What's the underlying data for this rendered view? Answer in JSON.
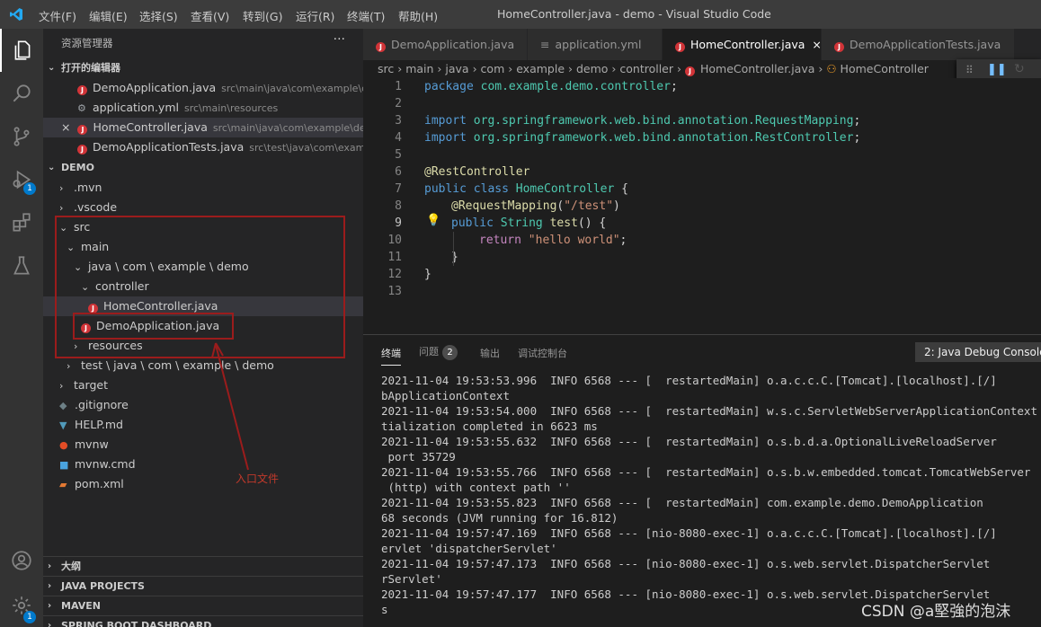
{
  "titlebar": {
    "menus": [
      "文件(F)",
      "编辑(E)",
      "选择(S)",
      "查看(V)",
      "转到(G)",
      "运行(R)",
      "终端(T)",
      "帮助(H)"
    ],
    "title": "HomeController.java - demo - Visual Studio Code"
  },
  "activity": {
    "run_badge": "1",
    "account_badge": "1"
  },
  "sidebar": {
    "title": "资源管理器",
    "more": "···",
    "open_editors_label": "打开的编辑器",
    "open_editors": [
      {
        "name": "DemoApplication.java",
        "path": "src\\main\\java\\com\\example\\d...",
        "icon": "java-icon"
      },
      {
        "name": "application.yml",
        "path": "src\\main\\resources",
        "icon": "gear-icon"
      },
      {
        "name": "HomeController.java",
        "path": "src\\main\\java\\com\\example\\de...",
        "icon": "java-icon",
        "close": "×"
      },
      {
        "name": "DemoApplicationTests.java",
        "path": "src\\test\\java\\com\\exampl...",
        "icon": "java-icon"
      }
    ],
    "project_label": "DEMO",
    "tree": [
      {
        "label": ".mvn",
        "chev": "›"
      },
      {
        "label": ".vscode",
        "chev": "›"
      },
      {
        "label": "src",
        "chev": "⌄"
      },
      {
        "label": "main",
        "chev": "⌄"
      },
      {
        "label": "java \\ com \\ example \\ demo",
        "chev": "⌄"
      },
      {
        "label": "controller",
        "chev": "⌄"
      },
      {
        "label": "HomeController.java"
      },
      {
        "label": "DemoApplication.java"
      },
      {
        "label": "resources",
        "chev": "›"
      },
      {
        "label": "test \\ java \\ com \\ example \\ demo",
        "chev": "›"
      },
      {
        "label": "target",
        "chev": "›"
      },
      {
        "label": ".gitignore"
      },
      {
        "label": "HELP.md"
      },
      {
        "label": "mvnw"
      },
      {
        "label": "mvnw.cmd"
      },
      {
        "label": "pom.xml"
      }
    ],
    "outline_label": "大纲",
    "java_projects_label": "JAVA PROJECTS",
    "maven_label": "MAVEN",
    "spring_label": "SPRING BOOT DASHBOARD"
  },
  "tabs": [
    {
      "label": "DemoApplication.java",
      "icon": "java-icon"
    },
    {
      "label": "application.yml",
      "icon": "settings-icon"
    },
    {
      "label": "HomeController.java",
      "icon": "java-icon",
      "active": true,
      "close": "×"
    },
    {
      "label": "DemoApplicationTests.java",
      "icon": "java-icon"
    }
  ],
  "breadcrumb": [
    "src",
    "main",
    "java",
    "com",
    "example",
    "demo",
    "controller",
    "HomeController.java",
    "HomeController"
  ],
  "code": {
    "line_numbers": [
      "1",
      "2",
      "3",
      "4",
      "5",
      "6",
      "7",
      "8",
      "9",
      "10",
      "11",
      "12",
      "13"
    ],
    "l1a": "package ",
    "l1b": "com.example.demo.controller",
    ";": ";",
    "l3a": "import ",
    "l3b": "org.springframework.web.bind.annotation.RequestMapping",
    "l4b": "org.springframework.web.bind.annotation.RestController",
    "l6a": "@",
    "l6b": "RestController",
    "l7a": "public class ",
    "l7b": "HomeController",
    " l7c": " {",
    "l8a": "@",
    "l8b": "RequestMapping",
    "l8c": "(",
    "l8d": "\"/test\"",
    "l8e": ")",
    "l9a": "public ",
    "l9b": "String ",
    "l9c": "test",
    "l9d": "() {",
    "l10a": "return ",
    "l10b": "\"hello world\"",
    "l11": "}",
    "l12": "}"
  },
  "panel": {
    "terminal_tab": "终端",
    "problems_tab": "问题",
    "problems_count": "2",
    "output_tab": "输出",
    "debug_tab": "调试控制台",
    "selector": "2: Java Debug Console",
    "lines": [
      "2021-11-04 19:53:53.996  INFO 6568 --- [  restartedMain] o.a.c.c.C.[Tomcat].[localhost].[/]       : Initi",
      "bApplicationContext",
      "2021-11-04 19:53:54.000  INFO 6568 --- [  restartedMain] w.s.c.ServletWebServerApplicationContext : Root",
      "tialization completed in 6623 ms",
      "2021-11-04 19:53:55.632  INFO 6568 --- [  restartedMain] o.s.b.d.a.OptionalLiveReloadServer       : LiveR",
      " port 35729",
      "2021-11-04 19:53:55.766  INFO 6568 --- [  restartedMain] o.s.b.w.embedded.tomcat.TomcatWebServer  : Tomca",
      " (http) with context path ''",
      "2021-11-04 19:53:55.823  INFO 6568 --- [  restartedMain] com.example.demo.DemoApplication         : Start",
      "68 seconds (JVM running for 16.812)",
      "2021-11-04 19:57:47.169  INFO 6568 --- [nio-8080-exec-1] o.a.c.c.C.[Tomcat].[localhost].[/]       : Initi",
      "ervlet 'dispatcherServlet'",
      "2021-11-04 19:57:47.173  INFO 6568 --- [nio-8080-exec-1] o.s.web.servlet.DispatcherServlet        : Initi",
      "rServlet'",
      "2021-11-04 19:57:47.177  INFO 6568 --- [nio-8080-exec-1] o.s.web.servlet.DispatcherServlet        : Compl",
      "s"
    ]
  },
  "annotation": {
    "text": "入口文件"
  },
  "watermark": "CSDN @a堅強的泡沫",
  "colors": {
    "accent": "#007acc",
    "java_icon": "#d13438",
    "annotation": "#9b1c1c"
  }
}
